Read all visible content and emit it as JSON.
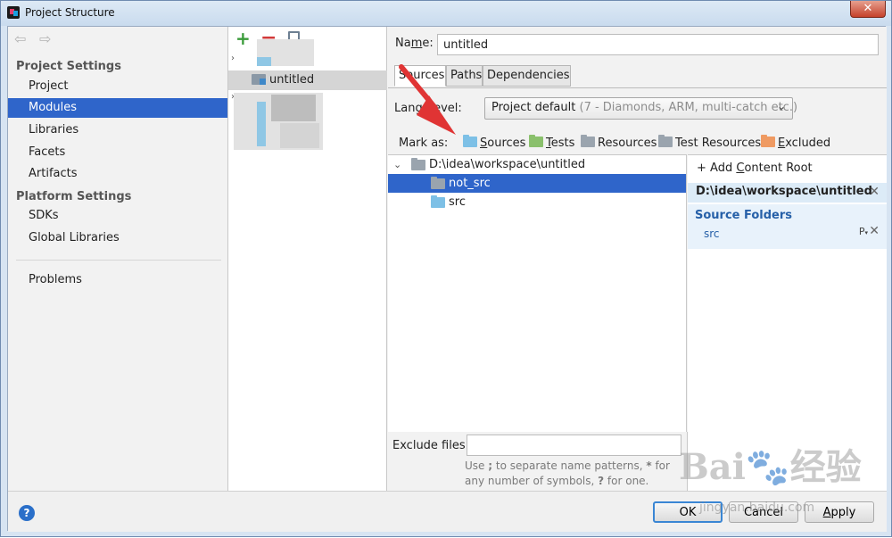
{
  "window": {
    "title": "Project Structure",
    "close_glyph": "✕"
  },
  "nav": {
    "back_glyph": "⇦",
    "forward_glyph": "⇨",
    "project_settings_title": "Project Settings",
    "project_settings_items": [
      "Project",
      "Modules",
      "Libraries",
      "Facets",
      "Artifacts"
    ],
    "platform_settings_title": "Platform Settings",
    "platform_settings_items": [
      "SDKs",
      "Global Libraries"
    ],
    "problems_label": "Problems",
    "selected_item": "Modules"
  },
  "modules_tree": {
    "add_glyph": "+",
    "remove_glyph": "−",
    "module_name": "untitled",
    "expander_glyph": "›"
  },
  "module": {
    "name_label_pre": "Na",
    "name_label_mn": "m",
    "name_label_post": "e:",
    "name_value": "untitled",
    "tabs": [
      "Sources",
      "Paths",
      "Dependencies"
    ],
    "active_tab": "Sources",
    "language_level_label": "Langu   evel:",
    "language_level_value": "Project default",
    "language_level_hint": "(7 - Diamonds, ARM, multi-catch etc.)",
    "chevron_glyph": "⌄",
    "mark_as_label": "Mark as:",
    "mark_as": [
      {
        "label": "Sources",
        "mnemonic": "S",
        "rest": "ources",
        "color": "#7dc0e6"
      },
      {
        "label": "Tests",
        "mnemonic": "T",
        "rest": "ests",
        "color": "#8ac06c"
      },
      {
        "label": "Resources",
        "color": "#9aa4ae"
      },
      {
        "label": "Test Resources",
        "color": "#9aa4ae"
      },
      {
        "label": "Excluded",
        "mnemonic": "E",
        "rest": "xcluded",
        "color": "#ef9a62"
      }
    ]
  },
  "content_tree": {
    "root": "D:\\idea\\workspace\\untitled",
    "children": [
      "not_src",
      "src"
    ],
    "selected": "not_src",
    "expander_glyph": "⌄"
  },
  "content_roots": {
    "add_glyph": "+",
    "add_label_pre": "Add ",
    "add_label_mn": "C",
    "add_label_post": "ontent Root",
    "root_path": "D:\\idea\\workspace\\untitled",
    "remove_glyph": "✕",
    "source_folders_title": "Source Folders",
    "source_folders": [
      "src"
    ],
    "props_glyph": "P",
    "props_sub_glyph": "▾"
  },
  "exclude": {
    "label": "Exclude files:",
    "value": "",
    "hint_1": "Use ",
    "hint_2": ";",
    "hint_3": " to separate name patterns, ",
    "hint_4": "*",
    "hint_5": " for any number of symbols, ",
    "hint_6": "?",
    "hint_7": " for one."
  },
  "buttons": {
    "help_glyph": "?",
    "ok": "OK",
    "cancel": "Cancel",
    "apply_mn": "A",
    "apply_rest": "pply"
  },
  "watermark": {
    "text": "Bai🐾经验",
    "sub": "jingyan.baidu.com"
  },
  "colors": {
    "selection": "#2f65ca",
    "annotation_arrow": "#e03434",
    "source_folder_text": "#2660a8"
  }
}
